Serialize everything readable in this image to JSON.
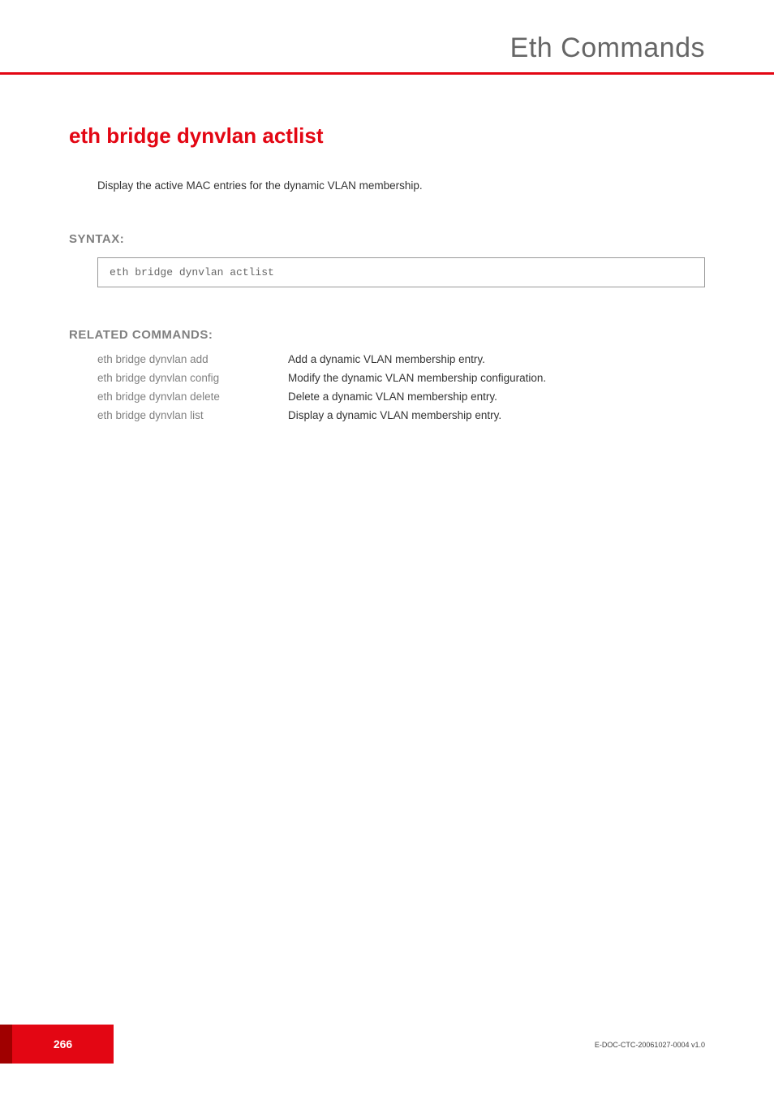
{
  "header": {
    "running_head": "Eth Commands"
  },
  "title": "eth bridge dynvlan actlist",
  "intro": "Display the active MAC entries for the dynamic VLAN membership.",
  "sections": {
    "syntax_label": "SYNTAX:",
    "syntax_code": "eth bridge dynvlan actlist",
    "related_label": "RELATED COMMANDS:"
  },
  "related": [
    {
      "cmd": "eth bridge dynvlan add",
      "desc": "Add a dynamic VLAN membership entry."
    },
    {
      "cmd": "eth bridge dynvlan config",
      "desc": "Modify the dynamic VLAN membership configuration."
    },
    {
      "cmd": "eth bridge dynvlan delete",
      "desc": "Delete a dynamic VLAN membership entry."
    },
    {
      "cmd": "eth bridge dynvlan list",
      "desc": "Display a dynamic VLAN membership entry."
    }
  ],
  "footer": {
    "docid": "E-DOC-CTC-20061027-0004 v1.0",
    "page_number": "266"
  }
}
